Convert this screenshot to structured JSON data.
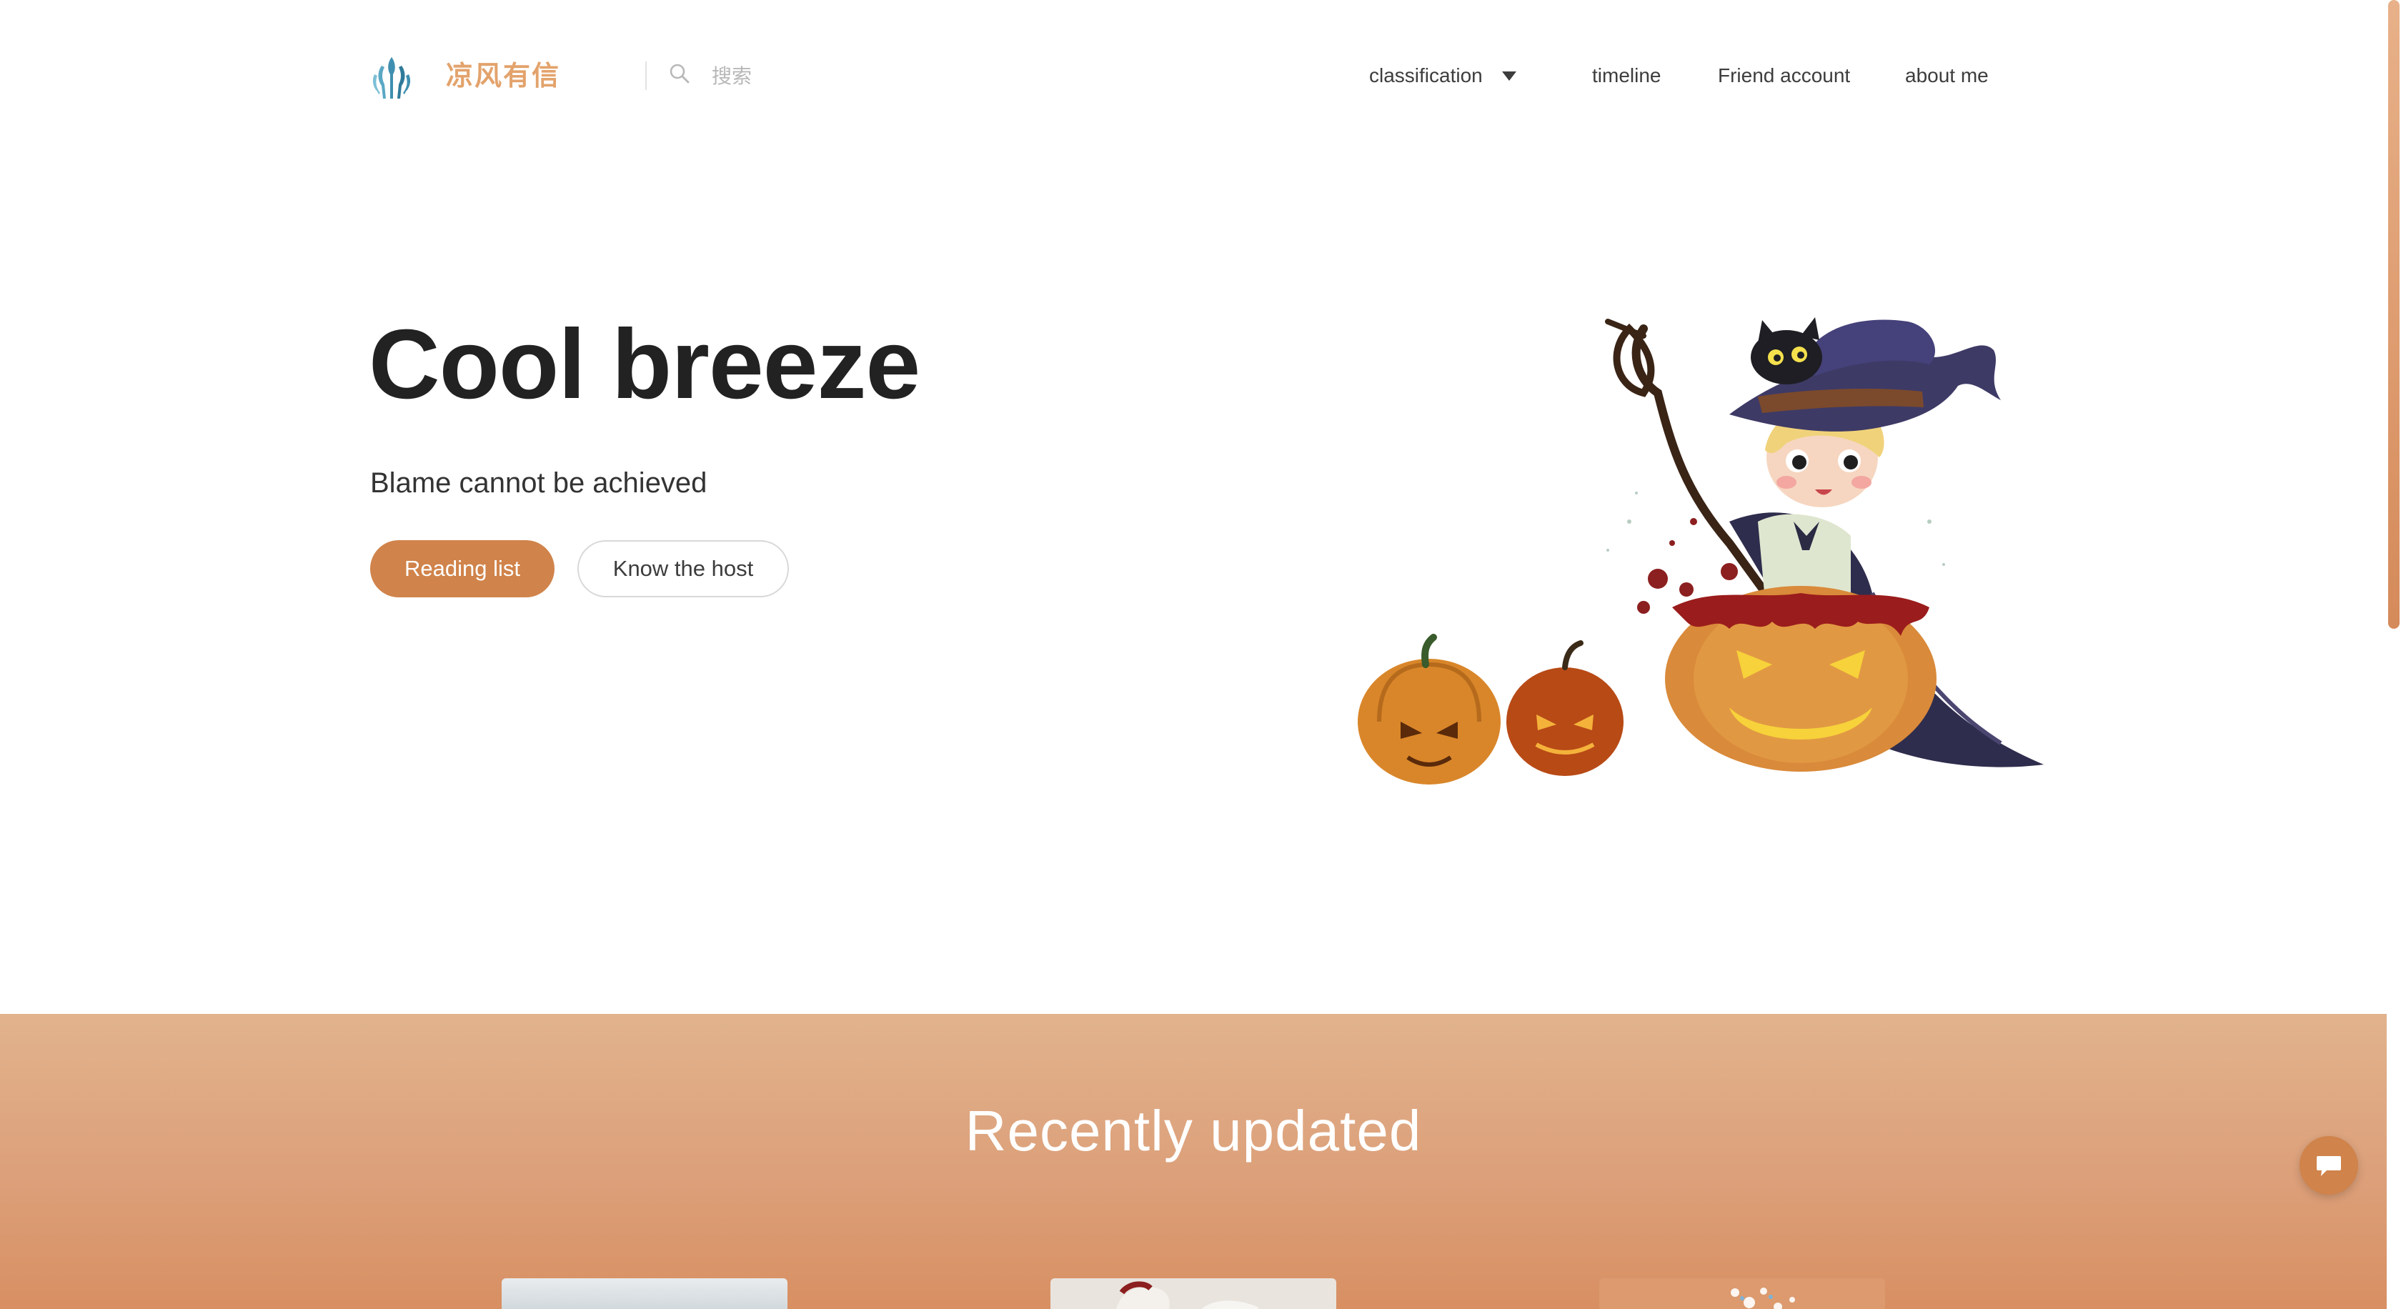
{
  "header": {
    "logo_icon": "tree-hand-logo-icon",
    "site_name": "凉风有信",
    "search": {
      "icon": "search-icon",
      "placeholder": "搜索",
      "value": ""
    },
    "nav": [
      {
        "label": "classification",
        "has_dropdown": true,
        "dropdown_icon": "caret-down-icon"
      },
      {
        "label": "timeline"
      },
      {
        "label": "Friend account"
      },
      {
        "label": "about me"
      }
    ]
  },
  "hero": {
    "title": "Cool breeze",
    "subtitle": "Blame cannot be achieved",
    "buttons": [
      {
        "label": "Reading list",
        "style": "primary"
      },
      {
        "label": "Know the host",
        "style": "secondary"
      }
    ],
    "illustration": "halloween-witch-pumpkins-illustration"
  },
  "recent": {
    "title": "Recently updated"
  },
  "floating": {
    "chat_icon": "chat-bubble-icon"
  },
  "colors": {
    "accent": "#d0834a",
    "logo_text": "#e3a36c",
    "band_top": "#e1b38d",
    "band_bottom": "#d88f62",
    "title_text": "#222222"
  }
}
